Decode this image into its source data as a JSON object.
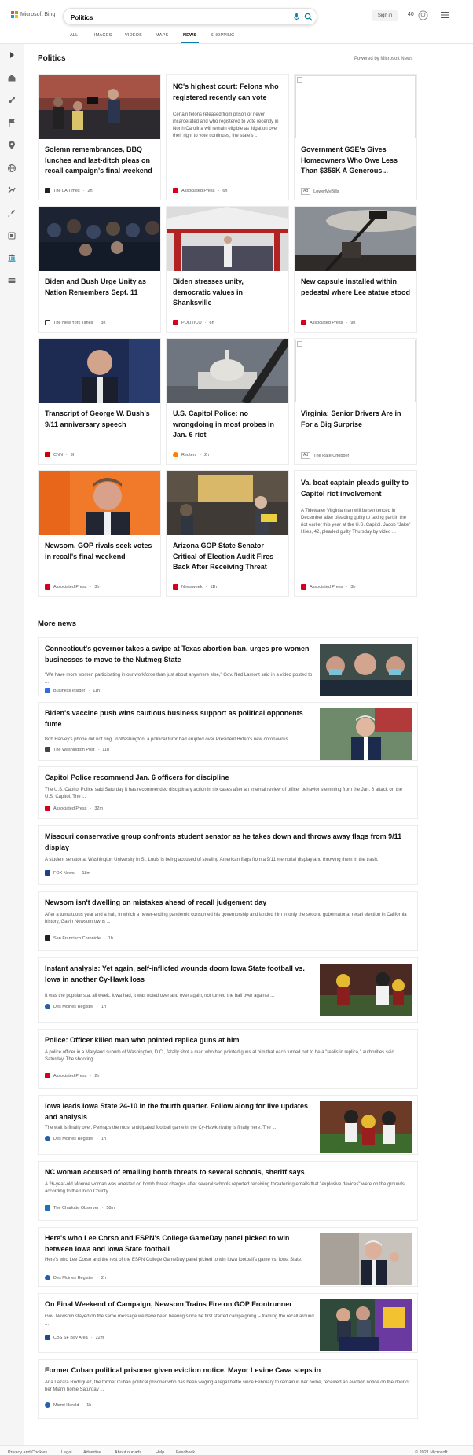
{
  "header": {
    "logo_text": "Microsoft Bing",
    "search_value": "Politics",
    "signin_label": "Sign in",
    "points": "40"
  },
  "tabs": [
    "ALL",
    "IMAGES",
    "VIDEOS",
    "MAPS",
    "NEWS",
    "SHOPPING"
  ],
  "section": {
    "title": "Politics",
    "powered_by": "Powered by Microsoft News"
  },
  "cards": [
    {
      "title": "Solemn remembrances, BBQ lunches and last-ditch pleas on recall campaign's final weekend",
      "source": "The LA Times",
      "time": "2h",
      "snippet": ""
    },
    {
      "title": "NC's highest court: Felons who registered recently can vote",
      "source": "Associated Press",
      "time": "6h",
      "snippet": "Certain felons released from prison or never incarcerated and who registered to vote recently in North Carolina will remain eligible as litigation over their right to vote continues, the state's ..."
    },
    {
      "title": "Government GSE's Gives Homeowners Who Owe Less Than $356K A Generous...",
      "source": "LowerMyBills",
      "ad_label": "Ad",
      "snippet": ""
    },
    {
      "title": "Biden and Bush Urge Unity as Nation Remembers Sept. 11",
      "source": "The New York Times",
      "time": "3h",
      "snippet": ""
    },
    {
      "title": "Biden stresses unity, democratic values in Shanksville",
      "source": "POLITICO",
      "time": "6h",
      "snippet": ""
    },
    {
      "title": "New capsule installed within pedestal where Lee statue stood",
      "source": "Associated Press",
      "time": "9h",
      "snippet": ""
    },
    {
      "title": "Transcript of George W. Bush's 9/11 anniversary speech",
      "source": "CNN",
      "time": "9h",
      "snippet": ""
    },
    {
      "title": "U.S. Capitol Police: no wrongdoing in most probes in Jan. 6 riot",
      "source": "Reuters",
      "time": "2h",
      "snippet": ""
    },
    {
      "title": "Virginia: Senior Drivers Are in For a Big Surprise",
      "source": "The Rate Chopper",
      "ad_label": "Ad",
      "snippet": ""
    },
    {
      "title": "Newsom, GOP rivals seek votes in recall's final weekend",
      "source": "Associated Press",
      "time": "3h",
      "snippet": ""
    },
    {
      "title": "Arizona GOP State Senator Critical of Election Audit Fires Back After Receiving Threat",
      "source": "Newsweek",
      "time": "11h",
      "snippet": ""
    },
    {
      "title": "Va. boat captain pleads guilty to Capitol riot involvement",
      "source": "Associated Press",
      "time": "3h",
      "snippet": "A Tidewater Virginia man will be sentenced in December after pleading guilty to taking part in the riot earlier this year at the U.S. Capitol. Jacob \"Jake\" Hiles, 42, pleaded guilty Thursday by video ..."
    }
  ],
  "more_news": {
    "title": "More news",
    "items": [
      {
        "title": "Connecticut's governor takes a swipe at Texas abortion ban, urges pro-women businesses to move to the Nutmeg State",
        "snippet": "\"We have more women participating in our workforce than just about anywhere else,\" Gov. Ned Lamont said in a video posted to ...",
        "source": "Business Insider",
        "time": "11h"
      },
      {
        "title": "Biden's vaccine push wins cautious business support as political opponents fume",
        "snippet": "Bob Harvey's phone did not ring. In Washington, a political furor had erupted over President Biden's new coronavirus ...",
        "source": "The Washington Post",
        "time": "11h"
      },
      {
        "title": "Capitol Police recommend Jan. 6 officers for discipline",
        "snippet": "The U.S. Capitol Police said Saturday it has recommended disciplinary action in six cases after an internal review of officer behavior stemming from the Jan. 6 attack on the U.S. Capitol. The ...",
        "source": "Associated Press",
        "time": "32m"
      },
      {
        "title": "Missouri conservative group confronts student senator as he takes down and throws away flags from 9/11 display",
        "snippet": "A student senator at Washington University in St. Louis is being accused of stealing American flags from a 9/11 memorial display and throwing them in the trash.",
        "source": "FOX News",
        "time": "18m"
      },
      {
        "title": "Newsom isn't dwelling on mistakes ahead of recall judgement day",
        "snippet": "After a tumultuous year and a half, in which a never-ending pandemic consumed his governorship and landed him in only the second gubernatorial recall election in California history, Gavin Newsom owns ...",
        "source": "San Francisco Chronicle",
        "time": "1h"
      },
      {
        "title": "Instant analysis: Yet again, self-inflicted wounds doom Iowa State football vs. Iowa in another Cy-Hawk loss",
        "snippet": "It was the popular stat all week. Iowa had, it was noted over and over again, not turned the ball over against ...",
        "source": "Des Moines Register",
        "time": "1h"
      },
      {
        "title": "Police: Officer killed man who pointed replica guns at him",
        "snippet": "A police officer in a Maryland suburb of Washington, D.C., fatally shot a man who had pointed guns at him that each turned out to be a \"realistic replica,\" authorities said Saturday. The shooting ...",
        "source": "Associated Press",
        "time": "2h"
      },
      {
        "title": "Iowa leads Iowa State 24-10 in the fourth quarter. Follow along for live updates and analysis",
        "snippet": "The wait is finally over. Perhaps the most anticipated football game in the Cy-Hawk rivalry is finally here. The ...",
        "source": "Des Moines Register",
        "time": "1h"
      },
      {
        "title": "NC woman accused of emailing bomb threats to several schools, sheriff says",
        "snippet": "A 26-year-old Monroe woman was arrested on bomb threat charges after several schools reported receiving threatening emails that \"explosive devices\" were on the grounds, according to the Union County ...",
        "source": "The Charlotte Observer",
        "time": "58m"
      },
      {
        "title": "Here's who Lee Corso and ESPN's College GameDay panel picked to win between Iowa and Iowa State football",
        "snippet": "Here's who Lee Corso and the rest of the ESPN College GameDay panel picked to win Iowa football's game vs. Iowa State.",
        "source": "Des Moines Register",
        "time": "2h"
      },
      {
        "title": "On Final Weekend of Campaign, Newsom Trains Fire on GOP Frontrunner",
        "snippet": "Gov. Newsom stayed on the same message we have been hearing since he first started campaigning -- framing the recall around ...",
        "source": "CBS SF Bay Area",
        "time": "22m"
      },
      {
        "title": "Former Cuban political prisoner given eviction notice. Mayor Levine Cava steps in",
        "snippet": "Ana Lazara Rodriguez, the former Cuban political prisoner who has been waging a legal battle since February to remain in her home, received an eviction notice on the door of her Miami home Saturday ...",
        "source": "Miami Herald",
        "time": "1h"
      }
    ]
  },
  "footer": {
    "links": [
      "Privacy and Cookies",
      "Legal",
      "Advertise",
      "About our ads",
      "Help",
      "Feedback"
    ],
    "copyright": "© 2021 Microsoft"
  },
  "colors": {
    "accent": "#0a7ea4",
    "ap_red": "#d6001c",
    "logo": [
      "#f25022",
      "#7fba00",
      "#00a4ef",
      "#ffb900"
    ]
  }
}
